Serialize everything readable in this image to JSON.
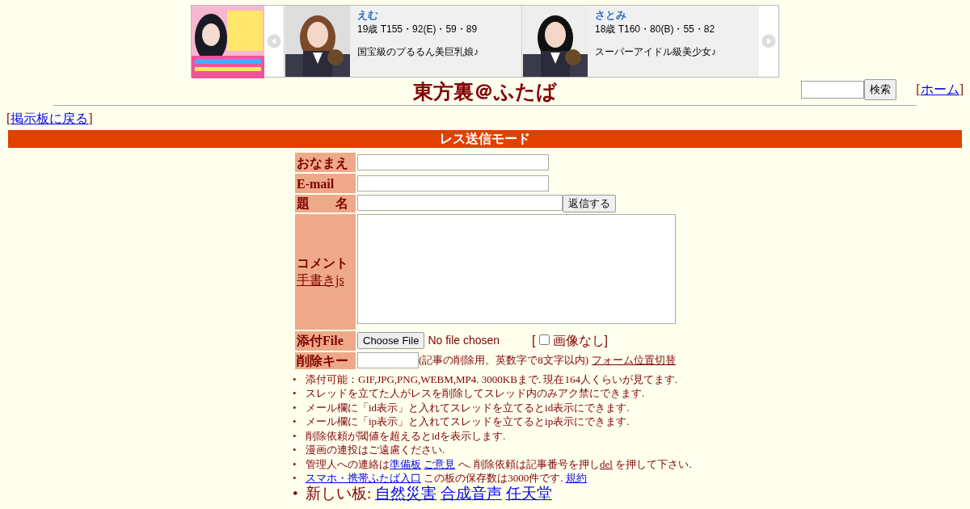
{
  "banner": {
    "profiles": [
      {
        "name": "えむ",
        "stats": "19歳 T155・92(E)・59・89",
        "tagline": "国宝級のプるるん美巨乳娘♪"
      },
      {
        "name": "さとみ",
        "stats": "18歳 T160・80(B)・55・82",
        "tagline": "スーパーアイドル級美少女♪"
      }
    ]
  },
  "header": {
    "title": "東方裏＠ふたば",
    "search_button": "検索",
    "home_open": "[",
    "home_link": "ホーム",
    "home_close": "]",
    "back_open": "[",
    "back_link": "掲示板に戻る",
    "back_close": "]"
  },
  "mode_bar": "レス送信モード",
  "form": {
    "rows": [
      {
        "kind": "text",
        "label": "おなまえ"
      },
      {
        "kind": "text",
        "label": "E-mail"
      },
      {
        "kind": "submit",
        "label": "題　　名",
        "button": "返信する"
      },
      {
        "kind": "textarea",
        "label": "コメント",
        "link": "手書きjs"
      },
      {
        "kind": "file",
        "label": "添付File",
        "file_button": "Choose File",
        "file_status": "No file chosen",
        "open": "[",
        "checkbox_label": "画像なし",
        "close": "]",
        "checked": false
      },
      {
        "kind": "key",
        "label": "削除キー",
        "note": "(記事の削除用。英数字で8文字以内)",
        "link": "フォーム位置切替"
      }
    ]
  },
  "notes": [
    {
      "marker": "•",
      "large": false,
      "parts": [
        {
          "kind": "text",
          "text": "添付可能：GIF,JPG,PNG,WEBM,MP4. 3000KBまで. 現在164人くらいが見てます."
        }
      ]
    },
    {
      "marker": "•",
      "large": false,
      "parts": [
        {
          "kind": "text",
          "text": "スレッドを立てた人がレスを削除してスレッド内のみアク禁にできます."
        }
      ]
    },
    {
      "marker": "•",
      "large": false,
      "parts": [
        {
          "kind": "text",
          "text": "メール欄に「id表示」と入れてスレッドを立てるとid表示にできます."
        }
      ]
    },
    {
      "marker": "•",
      "large": false,
      "parts": [
        {
          "kind": "text",
          "text": "メール欄に「ip表示」と入れてスレッドを立てるとip表示にできます."
        }
      ]
    },
    {
      "marker": "•",
      "large": false,
      "parts": [
        {
          "kind": "text",
          "text": "削除依頼が閾値を超えるとidを表示します."
        }
      ]
    },
    {
      "marker": "•",
      "large": false,
      "parts": [
        {
          "kind": "text",
          "text": "漫画の連投はご遠慮ください."
        }
      ]
    },
    {
      "marker": "•",
      "large": false,
      "parts": [
        {
          "kind": "text",
          "text": "管理人への連絡は"
        },
        {
          "kind": "link",
          "text": "準備板"
        },
        {
          "kind": "link",
          "text": "ご意見"
        },
        {
          "kind": "text",
          "text": "へ. 削除依頼は記事番号を押し"
        },
        {
          "kind": "dark-link",
          "text": "del"
        },
        {
          "kind": "text",
          "text": "を押して下さい."
        }
      ]
    },
    {
      "marker": "•",
      "large": false,
      "parts": [
        {
          "kind": "link",
          "text": "スマホ・携帯ふたば入口"
        },
        {
          "kind": "text",
          "text": "この板の保存数は3000件です."
        },
        {
          "kind": "link",
          "text": "規約"
        }
      ]
    },
    {
      "marker": "•",
      "large": true,
      "parts": [
        {
          "kind": "text",
          "text": "新しい板:"
        },
        {
          "kind": "link",
          "text": "自然災害"
        },
        {
          "kind": "link",
          "text": "合成音声"
        },
        {
          "kind": "link",
          "text": "任天堂"
        }
      ]
    }
  ]
}
